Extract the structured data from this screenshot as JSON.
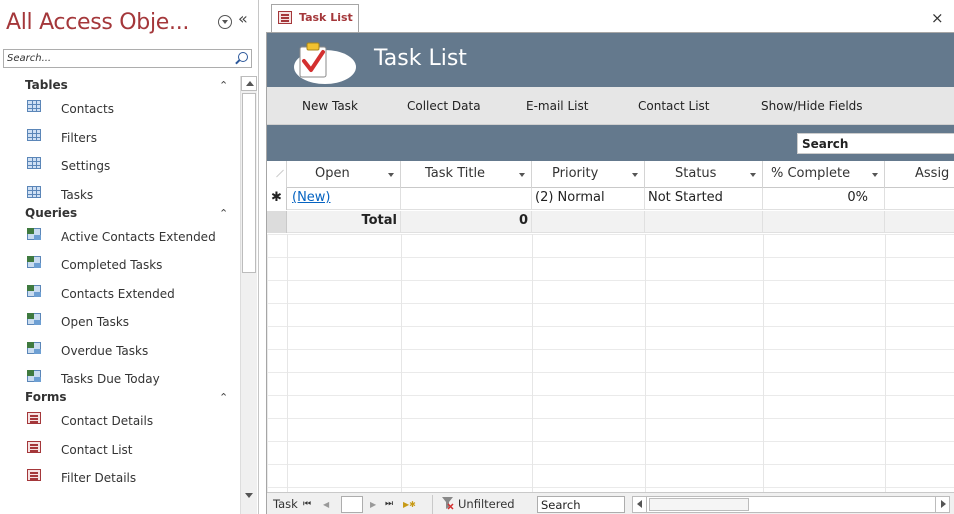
{
  "nav_pane": {
    "title": "All Access Obje...",
    "collapse_glyph": "«",
    "search_placeholder": "Search...",
    "groups": [
      {
        "label": "Tables",
        "items": [
          "Contacts",
          "Filters",
          "Settings",
          "Tasks"
        ]
      },
      {
        "label": "Queries",
        "items": [
          "Active Contacts Extended",
          "Completed Tasks",
          "Contacts Extended",
          "Open Tasks",
          "Overdue Tasks",
          "Tasks Due Today"
        ]
      },
      {
        "label": "Forms",
        "items": [
          "Contact Details",
          "Contact List",
          "Filter Details"
        ]
      }
    ]
  },
  "document": {
    "tab_label": "Task List",
    "close_glyph": "×",
    "header_title": "Task List",
    "commands": [
      "New Task",
      "Collect Data",
      "E-mail List",
      "Contact List",
      "Show/Hide Fields"
    ],
    "search_label": "Search"
  },
  "datasheet": {
    "columns": [
      "Open",
      "Task Title",
      "Priority",
      "Status",
      "% Complete",
      "Assig"
    ],
    "new_row": {
      "marker": "✱",
      "open": "(New)",
      "task_title": "",
      "priority": "(2) Normal",
      "status": "Not Started",
      "percent_complete": "0%"
    },
    "total_row": {
      "label": "Total",
      "task_title_count": "0"
    }
  },
  "record_nav": {
    "label": "Task",
    "first": "⏮",
    "prev": "◀",
    "next": "▶",
    "last": "⏭",
    "new": "▶✱",
    "filter_status": "Unfiltered",
    "search_value": "Search"
  },
  "colors": {
    "accent": "#a4373a",
    "header_bg": "#64798d",
    "link": "#0563c1"
  }
}
